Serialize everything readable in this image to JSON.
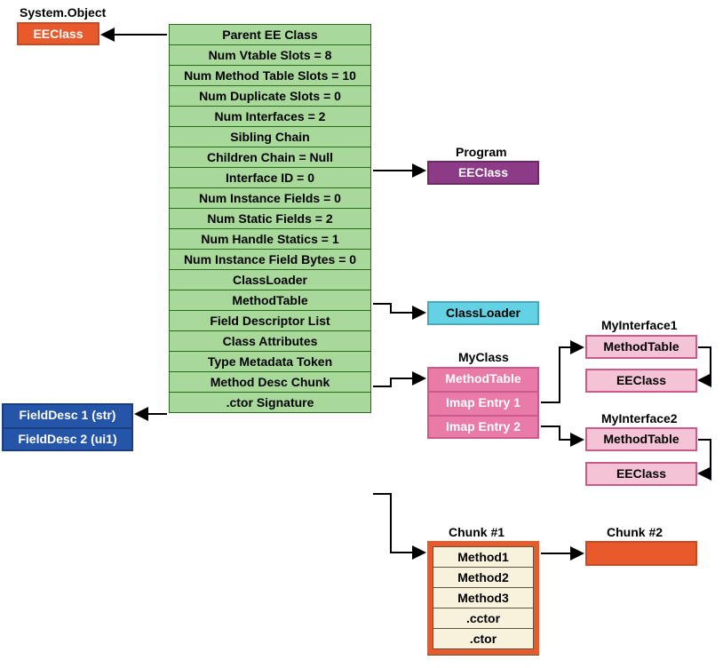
{
  "system_object": "System.Object",
  "eeClass_left": "EEClass",
  "field_desc1": "FieldDesc 1 (str)",
  "field_desc2": "FieldDesc 2 (ui1)",
  "green_rows": [
    "Parent EE Class",
    "Num Vtable Slots = 8",
    "Num Method Table Slots = 10",
    "Num Duplicate Slots = 0",
    "Num Interfaces = 2",
    "Sibling Chain",
    "Children Chain = Null",
    "Interface ID = 0",
    "Num Instance Fields = 0",
    "Num Static Fields = 2",
    "Num Handle Statics = 1",
    "Num Instance Field Bytes = 0",
    "ClassLoader",
    "MethodTable",
    "Field Descriptor List",
    "Class Attributes",
    "Type Metadata Token",
    "Method Desc Chunk",
    ".ctor Signature"
  ],
  "program_head": "Program",
  "program_eeClass": "EEClass",
  "classLoader": "ClassLoader",
  "myclass_head": "MyClass",
  "myclass_rows": [
    "MethodTable",
    "Imap Entry 1",
    "Imap Entry 2"
  ],
  "iface1_head": "MyInterface1",
  "iface1_rows": [
    "MethodTable",
    "EEClass"
  ],
  "iface2_head": "MyInterface2",
  "iface2_rows": [
    "MethodTable",
    "EEClass"
  ],
  "chunk1_head": "Chunk #1",
  "chunk1_rows": [
    "Method1",
    "Method2",
    "Method3",
    ".cctor",
    ".ctor"
  ],
  "chunk2_head": "Chunk #2"
}
